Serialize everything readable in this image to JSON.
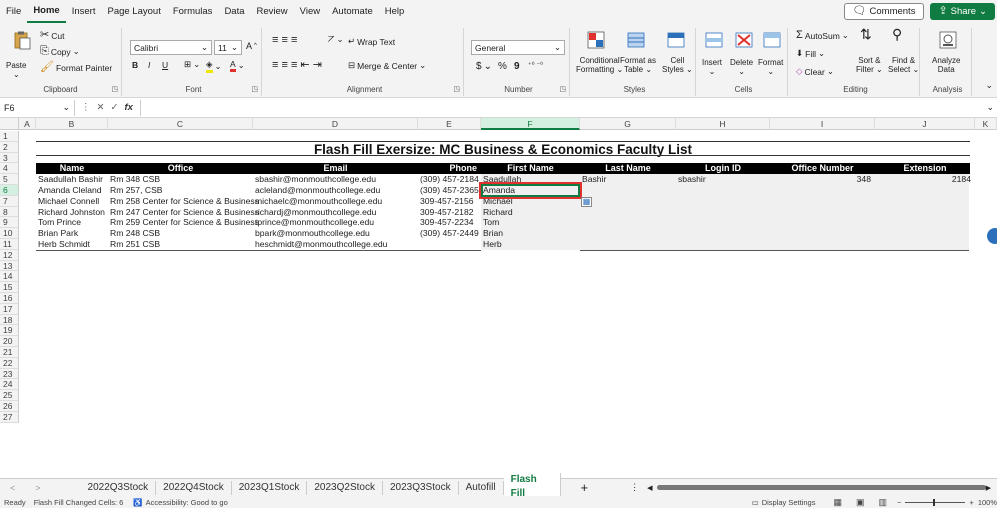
{
  "menu": {
    "items": [
      "File",
      "Home",
      "Insert",
      "Page Layout",
      "Formulas",
      "Data",
      "Review",
      "View",
      "Automate",
      "Help"
    ],
    "active": "Home",
    "comments_label": "Comments",
    "share_label": "Share"
  },
  "ribbon": {
    "clipboard": {
      "paste": "Paste",
      "cut": "Cut",
      "copy": "Copy",
      "format_painter": "Format Painter",
      "label": "Clipboard"
    },
    "font": {
      "name": "Calibri",
      "size": "11",
      "bold": "B",
      "italic": "I",
      "underline": "U",
      "label": "Font"
    },
    "alignment": {
      "wrap": "Wrap Text",
      "merge": "Merge & Center",
      "label": "Alignment"
    },
    "number": {
      "format": "General",
      "dollar": "$",
      "percent": "%",
      "comma": "9",
      "label": "Number"
    },
    "styles": {
      "conditional": "Conditional",
      "conditional2": "Formatting",
      "format_as": "Format as",
      "format_as2": "Table",
      "cell": "Cell",
      "cell2": "Styles",
      "label": "Styles"
    },
    "cells": {
      "insert": "Insert",
      "delete": "Delete",
      "format": "Format",
      "label": "Cells"
    },
    "editing": {
      "autosum": "AutoSum",
      "fill": "Fill",
      "clear": "Clear",
      "sort": "Sort &",
      "sort2": "Filter",
      "find": "Find &",
      "find2": "Select",
      "label": "Editing"
    },
    "analysis": {
      "analyze": "Analyze",
      "analyze2": "Data",
      "label": "Analysis"
    }
  },
  "formula_bar": {
    "name_box": "F6",
    "fx": "fx",
    "value": ""
  },
  "columns": [
    "A",
    "B",
    "C",
    "D",
    "E",
    "F",
    "G",
    "H",
    "I",
    "J",
    "K"
  ],
  "rows": [
    "1",
    "2",
    "3",
    "4",
    "5",
    "6",
    "7",
    "8",
    "9",
    "10",
    "11",
    "12",
    "13",
    "14",
    "15",
    "16",
    "17",
    "18",
    "19",
    "20",
    "21",
    "22",
    "23",
    "24",
    "25",
    "26",
    "27"
  ],
  "sheet": {
    "title": "Flash Fill Exersize: MC Business & Economics Faculty List",
    "headers": [
      "Name",
      "Office",
      "Email",
      "Phone",
      "First Name",
      "Last Name",
      "Login ID",
      "Office Number",
      "Extension"
    ],
    "data": [
      [
        "Saadullah Bashir",
        "Rm 348 CSB",
        "sbashir@monmouthcollege.edu",
        "(309) 457-2184",
        "Saadullah",
        "Bashir",
        "sbashir",
        "348",
        "2184"
      ],
      [
        "Amanda Cleland",
        "Rm 257, CSB",
        "acleland@monmouthcollege.edu",
        "(309) 457-2365",
        "Amanda",
        "",
        "",
        "",
        ""
      ],
      [
        "Michael Connell",
        "Rm 258 Center for Science & Business",
        "michaelc@monmouthcollege.edu",
        "309-457-2156",
        "Michael",
        "",
        "",
        "",
        ""
      ],
      [
        "Richard Johnston",
        "Rm 247 Center for Science & Business",
        "richardj@monmouthcollege.edu",
        "309-457-2182",
        "Richard",
        "",
        "",
        "",
        ""
      ],
      [
        "Tom Prince",
        "Rm 259 Center for Science & Business",
        "tprince@monmouthcollege.edu",
        "309-457-2234",
        "Tom",
        "",
        "",
        "",
        ""
      ],
      [
        "Brian Park",
        "Rm 248 CSB",
        "bpark@monmouthcollege.edu",
        "(309) 457-2449",
        "Brian",
        "",
        "",
        "",
        ""
      ],
      [
        "Herb Schmidt",
        "Rm 251 CSB",
        "heschmidt@monmouthcollege.edu",
        "",
        "Herb",
        "",
        "",
        "",
        ""
      ]
    ]
  },
  "tabs": {
    "items": [
      "2022Q3Stock",
      "2022Q4Stock",
      "2023Q1Stock",
      "2023Q2Stock",
      "2023Q3Stock",
      "Autofill",
      "Flash Fill"
    ],
    "active": "Flash Fill",
    "add": "+"
  },
  "status": {
    "ready": "Ready",
    "flash": "Flash Fill Changed Cells: 6",
    "accessibility": "Accessibility: Good to go",
    "display": "Display Settings",
    "zoom": "100%"
  },
  "colors": {
    "accent": "#107c41",
    "highlight": "#e0312e"
  }
}
